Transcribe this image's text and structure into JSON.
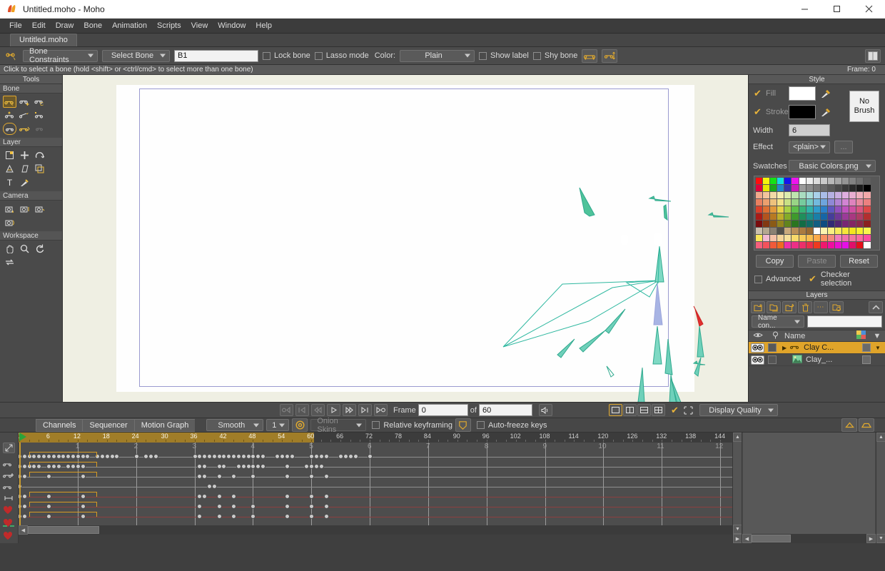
{
  "window": {
    "title": "Untitled.moho - Moho",
    "minimize": "—",
    "maximize": "□",
    "close": "✕"
  },
  "menubar": {
    "items": [
      "File",
      "Edit",
      "Draw",
      "Bone",
      "Animation",
      "Scripts",
      "View",
      "Window",
      "Help"
    ]
  },
  "document_tab": {
    "label": "Untitled.moho"
  },
  "toolbar": {
    "tool_icon": "bone-select-icon",
    "constraints_dropdown": "Bone Constraints",
    "tool_dropdown": "Select Bone",
    "bone_name_value": "B1",
    "lock_bone": "Lock bone",
    "lasso_mode": "Lasso mode",
    "color_label": "Color:",
    "color_dropdown": "Plain",
    "show_label": "Show label",
    "shy_bone": "Shy bone",
    "btn_flip_h": "flip-horizontal-bone-icon",
    "btn_flip_v": "flip-vertical-bone-icon",
    "btn_dual_pane": "dual-pane-icon"
  },
  "hintbar": {
    "text": "Click to select a bone (hold <shift> or <ctrl/cmd> to select more than one bone)",
    "frame_status": "Frame: 0"
  },
  "tools_panel": {
    "header": "Tools",
    "groups": [
      {
        "label": "Bone",
        "tools": [
          {
            "name": "select-bone-tool",
            "glyph": "⊶",
            "state": "selected"
          },
          {
            "name": "add-bone-tool",
            "glyph": "⊶",
            "state": "normal"
          },
          {
            "name": "reparent-bone-tool",
            "glyph": "⊶",
            "state": "normal"
          },
          {
            "name": "bone-strength-tool",
            "glyph": "⊷",
            "state": "normal"
          },
          {
            "name": "manipulate-bones-tool",
            "glyph": "⇢",
            "state": "normal"
          },
          {
            "name": "transform-bone-tool",
            "glyph": "⊶",
            "state": "normal"
          },
          {
            "name": "bind-layer-tool",
            "glyph": "⊂⊃",
            "state": "ring"
          },
          {
            "name": "bind-points-tool",
            "glyph": "⊶",
            "state": "normal"
          },
          {
            "name": "offset-bone-tool",
            "glyph": "❊",
            "state": "disabled"
          }
        ]
      },
      {
        "label": "Layer",
        "tools": [
          {
            "name": "transform-layer-tool",
            "glyph": "▣",
            "state": "normal"
          },
          {
            "name": "translate-layer-tool",
            "glyph": "✛",
            "state": "normal"
          },
          {
            "name": "rotate-layer-tool",
            "glyph": "↷",
            "state": "normal"
          },
          {
            "name": "scale-layer-tool",
            "glyph": "⌂",
            "state": "normal"
          },
          {
            "name": "shear-layer-tool",
            "glyph": "▱",
            "state": "normal"
          },
          {
            "name": "set-origin-tool",
            "glyph": "⧉",
            "state": "normal"
          },
          {
            "name": "text-tool",
            "glyph": "T",
            "state": "normal"
          },
          {
            "name": "eyedropper-tool",
            "glyph": "✎",
            "state": "normal"
          }
        ]
      },
      {
        "label": "Camera",
        "tools": [
          {
            "name": "track-camera-tool",
            "glyph": "▤",
            "state": "normal"
          },
          {
            "name": "zoom-camera-tool",
            "glyph": "▤",
            "state": "normal"
          },
          {
            "name": "roll-camera-tool",
            "glyph": "▤",
            "state": "normal"
          },
          {
            "name": "pan-tilt-camera-tool",
            "glyph": "▤",
            "state": "normal"
          }
        ]
      },
      {
        "label": "Workspace",
        "tools": [
          {
            "name": "pan-workspace-tool",
            "glyph": "✋",
            "state": "normal"
          },
          {
            "name": "zoom-workspace-tool",
            "glyph": "🔍",
            "state": "normal"
          },
          {
            "name": "rotate-workspace-tool",
            "glyph": "↻",
            "state": "normal"
          },
          {
            "name": "orbit-workspace-tool",
            "glyph": "⇄",
            "state": "normal"
          }
        ]
      }
    ]
  },
  "style_panel": {
    "header": "Style",
    "fill_label": "Fill",
    "fill_color": "#ffffff",
    "fill_checked": true,
    "stroke_label": "Stroke",
    "stroke_color": "#000000",
    "stroke_checked": true,
    "no_brush_label": "No\nBrush",
    "no_brush_line1": "No",
    "no_brush_line2": "Brush",
    "width_label": "Width",
    "width_value": "6",
    "effect_label": "Effect",
    "effect_value": "<plain>",
    "effect_more": "...",
    "swatches_label": "Swatches",
    "swatches_value": "Basic Colors.png",
    "copy_label": "Copy",
    "paste_label": "Paste",
    "reset_label": "Reset",
    "advanced_label": "Advanced",
    "advanced_checked": false,
    "checker_label": "Checker selection",
    "checker_checked": true,
    "swatch_rows": [
      [
        "#ff0d0d",
        "#f5f50b",
        "#15e215",
        "#12e0e0",
        "#1414ee",
        "#ee14ee",
        "#ffffff",
        "#ededed",
        "#dcdcdc",
        "#cacaca",
        "#b8b8b8",
        "#a6a6a6",
        "#949494",
        "#828282",
        "#707070",
        "#5e5e5e"
      ],
      [
        "#e0003c",
        "#e8e800",
        "#1aa81a",
        "#2288cc",
        "#3535a8",
        "#cc1abb",
        "#9a9a9a",
        "#8a8a8a",
        "#7a7a7a",
        "#6a6a6a",
        "#5a5a5a",
        "#4a4a4a",
        "#3a3a3a",
        "#2a2a2a",
        "#1a1a1a",
        "#000000"
      ],
      [
        "#f0a98c",
        "#f3c49d",
        "#f2d9a6",
        "#f5ecb0",
        "#dcebae",
        "#bfe3ae",
        "#a9dcc0",
        "#a9dcd8",
        "#a9d0ea",
        "#a9bde8",
        "#b5b0e2",
        "#c9aee0",
        "#dfaee0",
        "#e8aed0",
        "#efb0bd",
        "#f2a8a8"
      ],
      [
        "#e98060",
        "#ec9f6e",
        "#eec27c",
        "#f2e289",
        "#c9e084",
        "#99d486",
        "#76cb9e",
        "#73cbc4",
        "#72bade",
        "#6ea4dd",
        "#8f88d6",
        "#b183d4",
        "#d184d3",
        "#de83bd",
        "#e88a9f",
        "#ec8080"
      ],
      [
        "#d8402a",
        "#dd6f32",
        "#e29a3c",
        "#e8d24a",
        "#a9d045",
        "#5cbf49",
        "#36b277",
        "#30b2a8",
        "#2f9ccc",
        "#2b80c9",
        "#5f57bf",
        "#9250bd",
        "#c052bd",
        "#cf50a1",
        "#da5580",
        "#dd4848"
      ],
      [
        "#aa1b16",
        "#b3531d",
        "#b87a22",
        "#bfae2a",
        "#85ab28",
        "#3e9a2c",
        "#1f8f5c",
        "#1a8f87",
        "#197fa8",
        "#1666a6",
        "#463d99",
        "#6f3897",
        "#9b3a98",
        "#a93881",
        "#b03c65",
        "#b22f2f"
      ],
      [
        "#7a0d0e",
        "#823812",
        "#8a5a16",
        "#93851d",
        "#62841d",
        "#2a7520",
        "#136c45",
        "#116c66",
        "#125f82",
        "#0e4c80",
        "#312a74",
        "#522672",
        "#772874",
        "#832663",
        "#88294c",
        "#8a2020"
      ],
      [
        "#cbbfae",
        "#b5a790",
        "#8a8073",
        "#52504a",
        "#c9a97c",
        "#b98f57",
        "#ab7b40",
        "#9b6930",
        "#ffffff",
        "#fbf3ae",
        "#f9ef84",
        "#f8ea5c",
        "#f6e63a",
        "#f5e41e",
        "#f7ef2f",
        "#f8f44e"
      ],
      [
        "#f8e55a",
        "#f2b9d2",
        "#f5c1a8",
        "#f4d49a",
        "#f6e09b",
        "#f7d96b",
        "#f8cb5a",
        "#f9be4f",
        "#fbaa4a",
        "#f88e60",
        "#f28a7f",
        "#f07dbe",
        "#ee70ac",
        "#f2769c",
        "#f96aa0",
        "#fa4ca0"
      ],
      [
        "#f4607c",
        "#f4515c",
        "#f15a3a",
        "#f06a22",
        "#ee2fa8",
        "#ed2f86",
        "#ec2f6a",
        "#ea2f4a",
        "#ef3a20",
        "#f0176e",
        "#ee0fa0",
        "#ea0fd0",
        "#e60fe6",
        "#e00f6a",
        "#e50f1a",
        "#fefefe"
      ]
    ]
  },
  "layers_panel": {
    "header": "Layers",
    "toolbar_buttons": [
      {
        "name": "new-layer-button",
        "glyph": "▣"
      },
      {
        "name": "duplicate-layer-button",
        "glyph": "⧉"
      },
      {
        "name": "new-group-button",
        "glyph": "▤"
      },
      {
        "name": "delete-layer-button",
        "glyph": "🗑"
      },
      {
        "name": "more-options-button",
        "glyph": "⋯"
      },
      {
        "name": "merge-layers-button",
        "glyph": "⧉"
      }
    ],
    "collapse_button": "^",
    "filter_dropdown": "Name con...",
    "filter_value": "",
    "columns": {
      "visibility": "eye-column-icon",
      "lock": "lock-column-icon",
      "name": "Name",
      "color": "color-column-icon",
      "menu": "▼"
    },
    "rows": [
      {
        "name": "Clay C...",
        "type": "bone-group",
        "selected": true,
        "expand": "▶"
      },
      {
        "name": "Clay_...",
        "type": "image",
        "selected": false,
        "expand": ""
      }
    ]
  },
  "playback_bar": {
    "buttons": [
      {
        "name": "jump-to-start-button",
        "glyph": "◁|"
      },
      {
        "name": "previous-keyframe-button",
        "glyph": "|◁"
      },
      {
        "name": "step-back-button",
        "glyph": "◁◁"
      },
      {
        "name": "play-button",
        "glyph": "▷"
      },
      {
        "name": "fast-forward-button",
        "glyph": "▷▷"
      },
      {
        "name": "next-keyframe-button",
        "glyph": "▷|"
      },
      {
        "name": "jump-to-end-button",
        "glyph": "▷◯"
      }
    ],
    "frame_label": "Frame",
    "frame_value": "0",
    "of_label": "of",
    "total_frames_value": "60",
    "audio_button": "speaker-icon",
    "view_buttons": [
      {
        "name": "single-view-button",
        "glyph": "▫",
        "active": true
      },
      {
        "name": "two-pane-view-button",
        "glyph": "▯▯",
        "active": false
      },
      {
        "name": "three-pane-view-button",
        "glyph": "▤",
        "active": false
      },
      {
        "name": "four-pane-view-button",
        "glyph": "⊞",
        "active": false
      }
    ],
    "checkbox_render": {
      "label": "",
      "checked": true,
      "name": "enable-render-checkbox"
    },
    "crop_button": "crop-icon",
    "display_quality": "Display Quality"
  },
  "timeline": {
    "tabs": [
      {
        "label": "Channels",
        "active": true
      },
      {
        "label": "Sequencer",
        "active": false
      },
      {
        "label": "Motion Graph",
        "active": false
      }
    ],
    "interpolation": "Smooth",
    "interp_count": "1",
    "onion_icon": "onion-skin-icon",
    "onion_skins": "Onion Skins",
    "relative_keyframing": "Relative keyframing",
    "relative_keyframing_checked": false,
    "shield_icon": "shield-icon",
    "auto_freeze_keys": "Auto-freeze keys",
    "auto_freeze_checked": false,
    "right_buttons": [
      {
        "name": "collapse-channels-button",
        "glyph": "▲"
      },
      {
        "name": "expand-channels-button",
        "glyph": "▬"
      }
    ],
    "ruler_ticks": [
      0,
      6,
      12,
      18,
      24,
      30,
      36,
      42,
      48,
      54,
      60,
      66,
      72,
      78,
      84,
      90,
      96,
      102,
      108,
      114,
      120,
      126,
      132,
      138,
      144
    ],
    "ruler_end_frame": 60,
    "playhead_frame": 0,
    "second_labels": [
      1,
      2,
      3,
      4,
      5,
      6,
      7,
      8,
      9,
      10,
      11,
      12
    ],
    "channels": [
      {
        "name": "bone-rotation-channel",
        "icon": "bone-rotate-icon",
        "color": "gray",
        "keys": [
          0,
          1,
          2,
          3,
          4,
          5,
          6,
          7,
          8,
          9,
          10,
          11,
          12,
          13,
          14,
          16,
          17,
          18,
          19,
          20,
          24,
          26,
          27,
          28,
          36,
          37,
          38,
          39,
          40,
          41,
          42,
          43,
          44,
          45,
          46,
          47,
          48,
          49,
          50,
          53,
          54,
          55,
          56,
          60,
          61,
          62,
          63,
          66,
          67,
          68,
          69,
          72
        ]
      },
      {
        "name": "bone-translation-channel",
        "icon": "bone-translate-icon",
        "color": "gray",
        "keys": [
          0,
          1,
          2,
          3,
          4,
          6,
          7,
          8,
          10,
          11,
          12,
          13,
          37,
          38,
          41,
          42,
          45,
          46,
          47,
          48,
          49,
          50,
          55,
          59,
          60,
          61,
          62
        ]
      },
      {
        "name": "bone-scale-channel",
        "icon": "bone-scale-icon",
        "color": "gray",
        "keys": [
          0,
          1,
          6,
          13,
          37,
          38,
          41,
          44,
          48,
          55,
          60,
          63
        ]
      },
      {
        "name": "bone-strength-channel",
        "icon": "bone-strength-icon",
        "color": "gray",
        "keys": [
          0,
          39,
          40
        ]
      },
      {
        "name": "layer-transform-channel",
        "icon": "layer-red-icon",
        "color": "red",
        "keys": [
          0,
          1,
          6,
          13,
          37,
          38,
          41,
          44,
          55,
          60,
          63
        ]
      },
      {
        "name": "layer-order-channel",
        "icon": "layer-order-red-icon",
        "color": "red",
        "keys": [
          0,
          1,
          6,
          13,
          37,
          41,
          44,
          48,
          55,
          60,
          63
        ]
      },
      {
        "name": "layer-visibility-channel",
        "icon": "layer-visibility-red-icon",
        "color": "red",
        "keys": [
          0,
          1,
          6,
          13,
          37,
          41,
          44,
          48,
          55,
          60,
          63
        ]
      }
    ]
  }
}
